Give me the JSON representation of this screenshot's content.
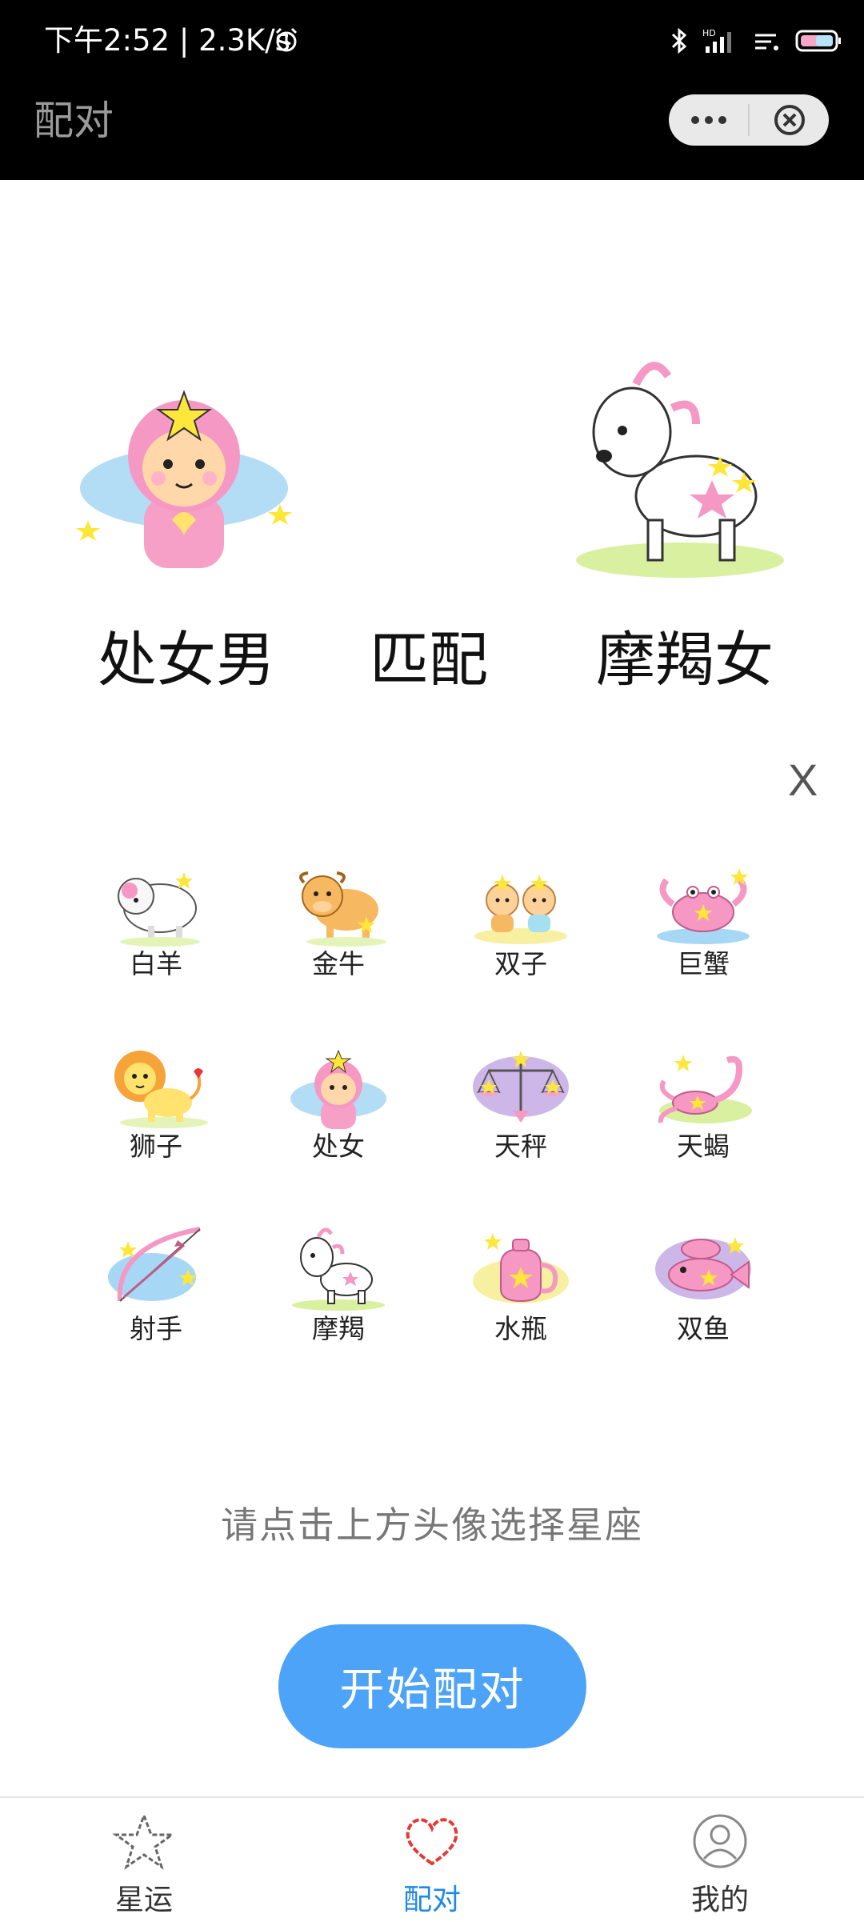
{
  "status_bar": {
    "text": "下午2:52 | 2.3K/s"
  },
  "header": {
    "title": "配对"
  },
  "match": {
    "left_label": "处女男",
    "middle_label": "匹配",
    "right_label": "摩羯女",
    "close_label": "X"
  },
  "zodiac": [
    {
      "name": "白羊",
      "icon": "aries-ram-icon"
    },
    {
      "name": "金牛",
      "icon": "taurus-bull-icon"
    },
    {
      "name": "双子",
      "icon": "gemini-twins-icon"
    },
    {
      "name": "巨蟹",
      "icon": "cancer-crab-icon"
    },
    {
      "name": "狮子",
      "icon": "leo-lion-icon"
    },
    {
      "name": "处女",
      "icon": "virgo-girl-icon"
    },
    {
      "name": "天秤",
      "icon": "libra-scales-icon"
    },
    {
      "name": "天蝎",
      "icon": "scorpio-scorpion-icon"
    },
    {
      "name": "射手",
      "icon": "sagittarius-bow-icon"
    },
    {
      "name": "摩羯",
      "icon": "capricorn-goat-icon"
    },
    {
      "name": "水瓶",
      "icon": "aquarius-jar-icon"
    },
    {
      "name": "双鱼",
      "icon": "pisces-fish-icon"
    }
  ],
  "hint": "请点击上方头像选择星座",
  "start_button": "开始配对",
  "tabbar": {
    "tabs": [
      {
        "label": "星运",
        "icon": "star-icon",
        "active": false
      },
      {
        "label": "配对",
        "icon": "heart-icon",
        "active": true
      },
      {
        "label": "我的",
        "icon": "user-icon",
        "active": false
      }
    ]
  },
  "colors": {
    "accent": "#4da3f7",
    "tab_active": "#1e88e5",
    "heart": "#e53935"
  }
}
